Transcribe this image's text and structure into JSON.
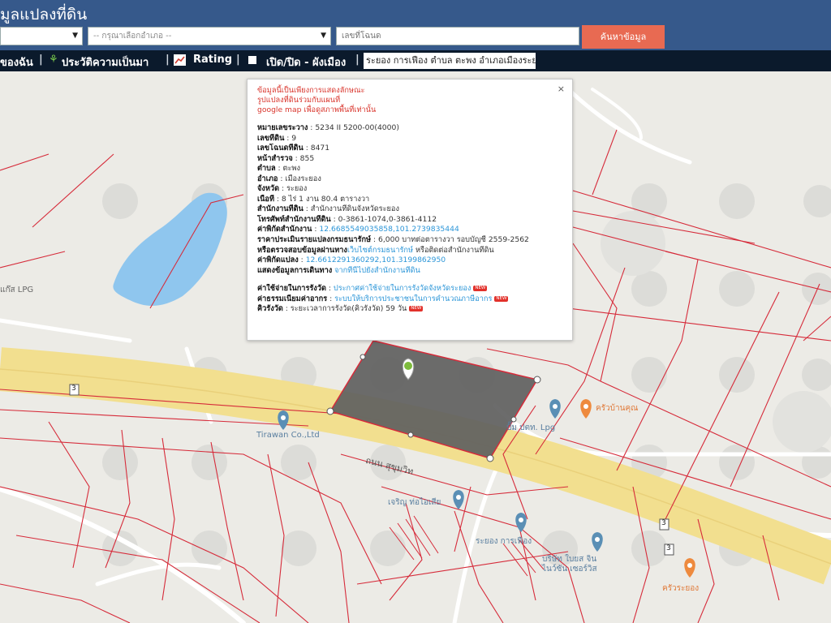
{
  "header": {
    "title": "มูลแปลงที่ดิน",
    "province_select": "",
    "district_placeholder": "-- กรุณาเลือกอำเภอ --",
    "deed_placeholder": "เลขที่โฉนด",
    "search_button": "ค้นหาข้อมูล"
  },
  "menu": {
    "mine": "ของฉัน",
    "history": "ประวัติความเป็นมา",
    "rating": "Rating",
    "toggle": "เปิด/ปิด - ผังเมือง",
    "address": "ระยอง การเฟือง ตำบล ตะพง อำเภอเมืองระยอง"
  },
  "popup": {
    "close": "×",
    "warnings": [
      "ข้อมูลนี้เป็นเพียงการแสดงลักษณะ",
      "รูปแปลงที่ดินร่วมกับแผนที่",
      "google map เพื่อดูสภาพพื้นที่เท่านั้น"
    ],
    "rows": [
      {
        "label": "หมายเลขระวาง",
        "value": " : 5234 II 5200-00(4000)"
      },
      {
        "label": "เลขที่ดิน",
        "value": " : 9"
      },
      {
        "label": "เลขโฉนดที่ดิน",
        "value": " : 8471"
      },
      {
        "label": "หน้าสำรวจ",
        "value": " : 855"
      },
      {
        "label": "ตำบล",
        "value": " : ตะพง"
      },
      {
        "label": "อำเภอ",
        "value": " : เมืองระยอง"
      },
      {
        "label": "จังหวัด",
        "value": " : ระยอง"
      },
      {
        "label": "เนื้อที่",
        "value": " : 8 ไร่ 1 งาน 80.4 ตารางวา"
      },
      {
        "label": "สำนักงานที่ดิน",
        "value": " : สำนักงานที่ดินจังหวัดระยอง"
      },
      {
        "label": "โทรศัพท์สำนักงานที่ดิน",
        "value": " : 0-3861-1074,0-3861-4112"
      },
      {
        "label": "ค่าพิกัดสำนักงาน",
        "value": " : ",
        "link": "12.6685549035858,101.2739835444"
      },
      {
        "label": "ราคาประเมินรายแปลงกรมธนารักษ์",
        "value": " : 6,000 บาทต่อตารางวา รอบบัญชี 2559-2562"
      },
      {
        "label": "หรือตรวจสอบข้อมูลผ่านทาง",
        "value": "",
        "link": "เว็บไซต์กรมธนารักษ์",
        "suffix": " หรือติดต่อสำนักงานที่ดิน"
      },
      {
        "label": "ค่าพิกัดแปลง",
        "value": " : ",
        "link": "12.6612291360292,101.3199862950"
      },
      {
        "label": "แสดงข้อมูลการเดินทาง",
        "value": " ",
        "link": "จากที่นี่ไปยังสำนักงานที่ดิน"
      }
    ],
    "fee_rows": [
      {
        "label": "ค่าใช้จ่ายในการรังวัด",
        "value": " : ",
        "link": "ประกาศค่าใช้จ่ายในการรังวัดจังหวัดระยอง",
        "badge": "NEW"
      },
      {
        "label": "ค่าธรรมเนียมค่าอากร",
        "value": " : ",
        "link": "ระบบให้บริการประชาชนในการคำนวณภาษีอากร",
        "badge": "NEW"
      },
      {
        "label": "คิวรังวัด",
        "value": " : ระยะเวลาการรังวัด(คิวรังวัด) 59 วัน",
        "link": "",
        "badge": "NEW"
      }
    ]
  },
  "map": {
    "labels": {
      "lpg_left": "แก๊ส LPG",
      "tirawan": "Tirawan Co.,Ltd",
      "road": "ถนน สุขุมวิท",
      "ptt": "ปั๊ม ปตท. Lpg",
      "road_no_1": "3",
      "road_no_2": "3",
      "road_no_3": "3",
      "charoen": "เจริญ ท่อไอเสีย",
      "karnfueang": "ระยอง การเฟือง",
      "company": "บริษัท ใบยส จิน",
      "company2": "ไนว์ซัน เซอร์วิส",
      "restaurant": "ครัวบ้านคุณ",
      "restaurant2": "ครัวระยอง"
    },
    "colors": {
      "road": "#f2df8f",
      "parcel_line": "#d62b3a",
      "selected_parcel": "#5f5f5f",
      "pond": "#8fc6ee",
      "pin": "#5a8fb5",
      "food_pin": "#ee8a3e"
    }
  }
}
